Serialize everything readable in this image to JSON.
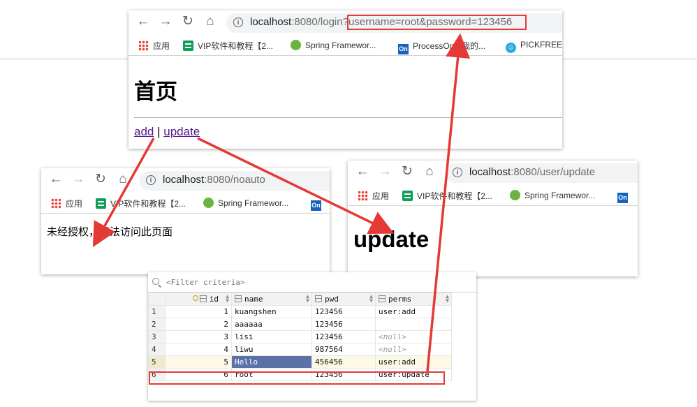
{
  "win1": {
    "url_host": "localhost",
    "url_rest": ":8080/login?",
    "url_query": "username=root&password=123456",
    "bookmarks": [
      "应用",
      "VIP软件和教程【2...",
      "Spring Framewor...",
      "ProcessOn - 我的...",
      "PICKFREE"
    ],
    "title": "首页",
    "link_add": "add",
    "separator": "|",
    "link_update": "update"
  },
  "win2": {
    "url_host": "localhost",
    "url_rest": ":8080/noauto",
    "bookmarks": [
      "应用",
      "VIP软件和教程【2...",
      "Spring Framewor..."
    ],
    "message": "未经授权，无法访问此页面"
  },
  "win3": {
    "url_host": "localhost",
    "url_rest": ":8080/user/update",
    "bookmarks": [
      "应用",
      "VIP软件和教程【2...",
      "Spring Framewor..."
    ],
    "title": "update"
  },
  "grid": {
    "filter_placeholder": "<Filter criteria>",
    "columns": [
      "id",
      "name",
      "pwd",
      "perms"
    ],
    "rows": [
      {
        "n": "1",
        "id": "1",
        "name": "kuangshen",
        "pwd": "123456",
        "perms": "user:add"
      },
      {
        "n": "2",
        "id": "2",
        "name": "aaaaaa",
        "pwd": "123456",
        "perms": ""
      },
      {
        "n": "3",
        "id": "3",
        "name": "lisi",
        "pwd": "123456",
        "perms": "<null>"
      },
      {
        "n": "4",
        "id": "4",
        "name": "liwu",
        "pwd": "987564",
        "perms": "<null>"
      },
      {
        "n": "5",
        "id": "5",
        "name": "Hello",
        "pwd": "456456",
        "perms": "user:add"
      },
      {
        "n": "6",
        "id": "6",
        "name": "root",
        "pwd": "123456",
        "perms": "user:update"
      }
    ]
  },
  "colors": {
    "annotation_red": "#e53935",
    "link_purple": "#551a8b",
    "selection_blue": "#5b72a8"
  }
}
